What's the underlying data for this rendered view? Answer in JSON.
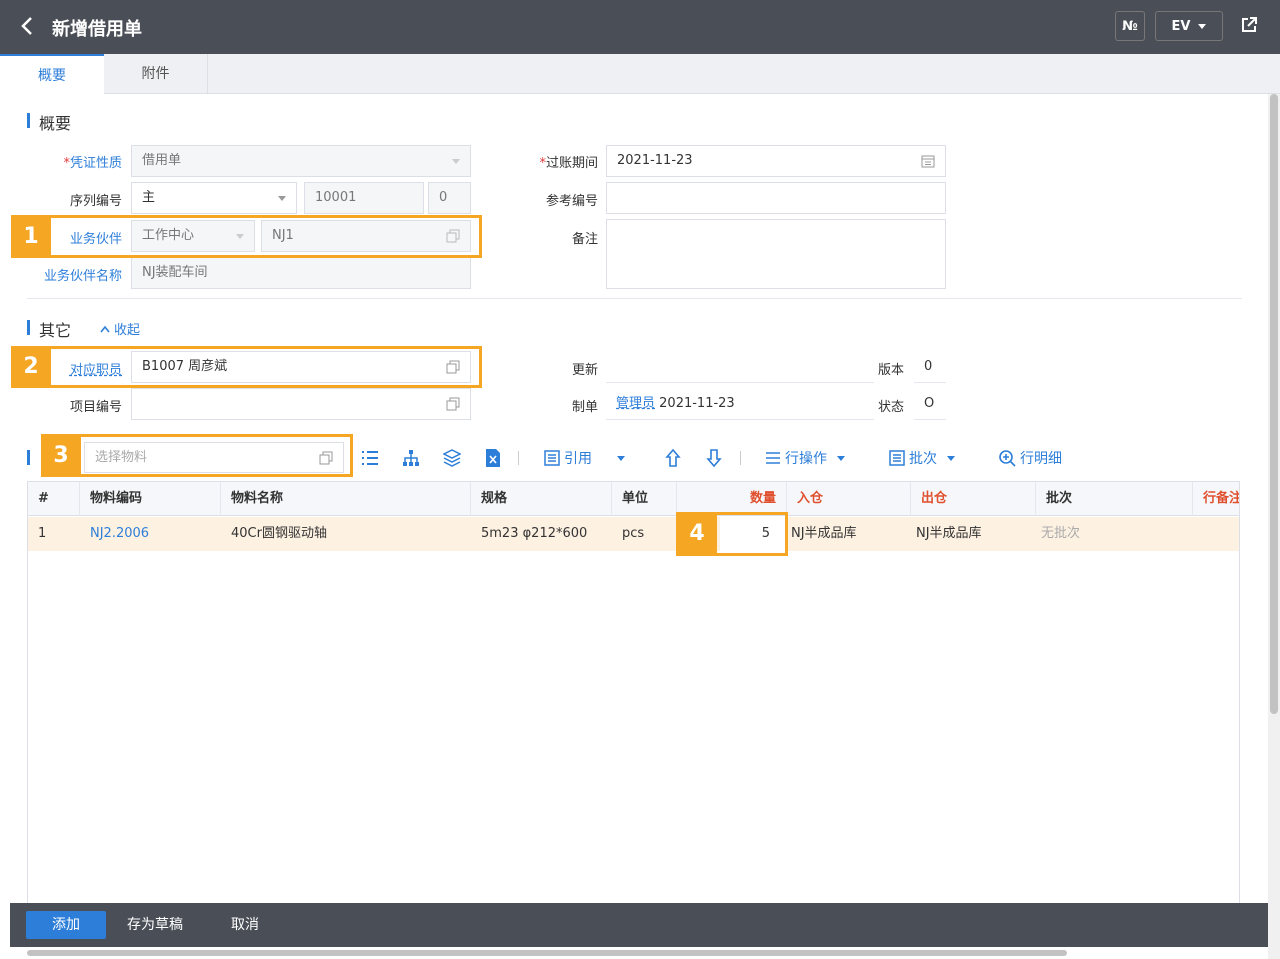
{
  "header": {
    "title": "新增借用单",
    "no_button": "№",
    "lang_button": "EV"
  },
  "tabs": [
    {
      "label": "概要",
      "active": true
    },
    {
      "label": "附件",
      "active": false
    }
  ],
  "overview": {
    "section_title": "概要",
    "voucher_type_label": "凭证性质",
    "voucher_type_value": "借用单",
    "serial_label": "序列编号",
    "serial_select": "主",
    "serial_number": "10001",
    "serial_suffix": "0",
    "partner_label": "业务伙伴",
    "partner_type": "工作中心",
    "partner_code": "NJ1",
    "partner_name_label": "业务伙伴名称",
    "partner_name_value": "NJ装配车间",
    "posting_date_label": "过账期间",
    "posting_date_value": "2021-11-23",
    "ref_no_label": "参考编号",
    "ref_no_value": "",
    "remark_label": "备注",
    "remark_value": ""
  },
  "other": {
    "section_title": "其它",
    "collapse_label": "收起",
    "employee_label": "对应职员",
    "employee_value": "B1007 周彦斌",
    "project_label": "项目编号",
    "project_value": "",
    "update_label": "更新",
    "update_value": "",
    "creator_label": "制单",
    "creator_name": "管理员",
    "creator_date": "2021-11-23",
    "version_label": "版本",
    "version_value": "0",
    "status_label": "状态",
    "status_value": "O"
  },
  "toolbar": {
    "material_placeholder": "选择物料",
    "reference_label": "引用",
    "row_ops_label": "行操作",
    "batch_label": "批次",
    "row_detail_label": "行明细"
  },
  "grid": {
    "columns": [
      "#",
      "物料编码",
      "物料名称",
      "规格",
      "单位",
      "数量",
      "入仓",
      "出仓",
      "批次",
      "行备注"
    ],
    "rows": [
      {
        "index": "1",
        "code": "NJ2.2006",
        "name": "40Cr圆钢驱动轴",
        "spec": "5m23 φ212*600",
        "unit": "pcs",
        "qty": "5",
        "in_wh": "NJ半成品库",
        "out_wh": "NJ半成品库",
        "batch": "无批次",
        "remark": ""
      }
    ]
  },
  "callouts": [
    "1",
    "2",
    "3",
    "4"
  ],
  "footer": {
    "add_label": "添加",
    "draft_label": "存为草稿",
    "cancel_label": "取消"
  },
  "colors": {
    "accent": "#2d7ed8",
    "highlight": "#f5a623",
    "header_bg": "#4a4f57"
  }
}
